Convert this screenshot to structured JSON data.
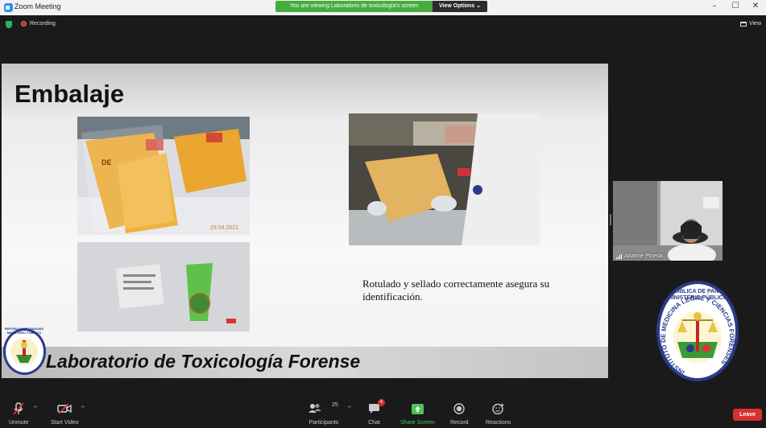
{
  "window": {
    "title": "Zoom Meeting",
    "minimize_glyph": "–",
    "maximize_glyph": "☐",
    "close_glyph": "✕"
  },
  "banner": {
    "message": "You are viewing Laboratorio de toxicología's screen",
    "options_label": "View Options ⌄"
  },
  "meeting_status": {
    "recording_label": "Recording",
    "view_label": "View"
  },
  "slide": {
    "title": "Embalaje",
    "caption": "Rotulado y sellado correctamente asegura su identificación.",
    "footer": "Laboratorio de Toxicología Forense",
    "photo1_date": "29.04.2021",
    "photo1_label": "DE",
    "seal_text": "REPÚBLICA DE PANAMÁ MINISTERIO PÚBLICO"
  },
  "participant": {
    "name": "Arianne Pineda"
  },
  "seal": {
    "top_line1": "REPÚBLICA DE PANAMÁ",
    "top_line2": "MINISTERIO PÚBLICO",
    "ring_text": "INSTITUTO DE MEDICINA LEGAL Y CIENCIAS FORENSES"
  },
  "toolbar": {
    "unmute": "Unmute",
    "start_video": "Start Video",
    "participants": "Participants",
    "participants_count": "25",
    "chat": "Chat",
    "chat_badge": "4",
    "share_screen": "Share Screen",
    "record": "Record",
    "reactions": "Reactions",
    "leave": "Leave"
  },
  "colors": {
    "share_green": "#4ec45a",
    "banner_green": "#44ad3e",
    "leave_red": "#d73131",
    "seal_blue": "#2c3a8c"
  }
}
